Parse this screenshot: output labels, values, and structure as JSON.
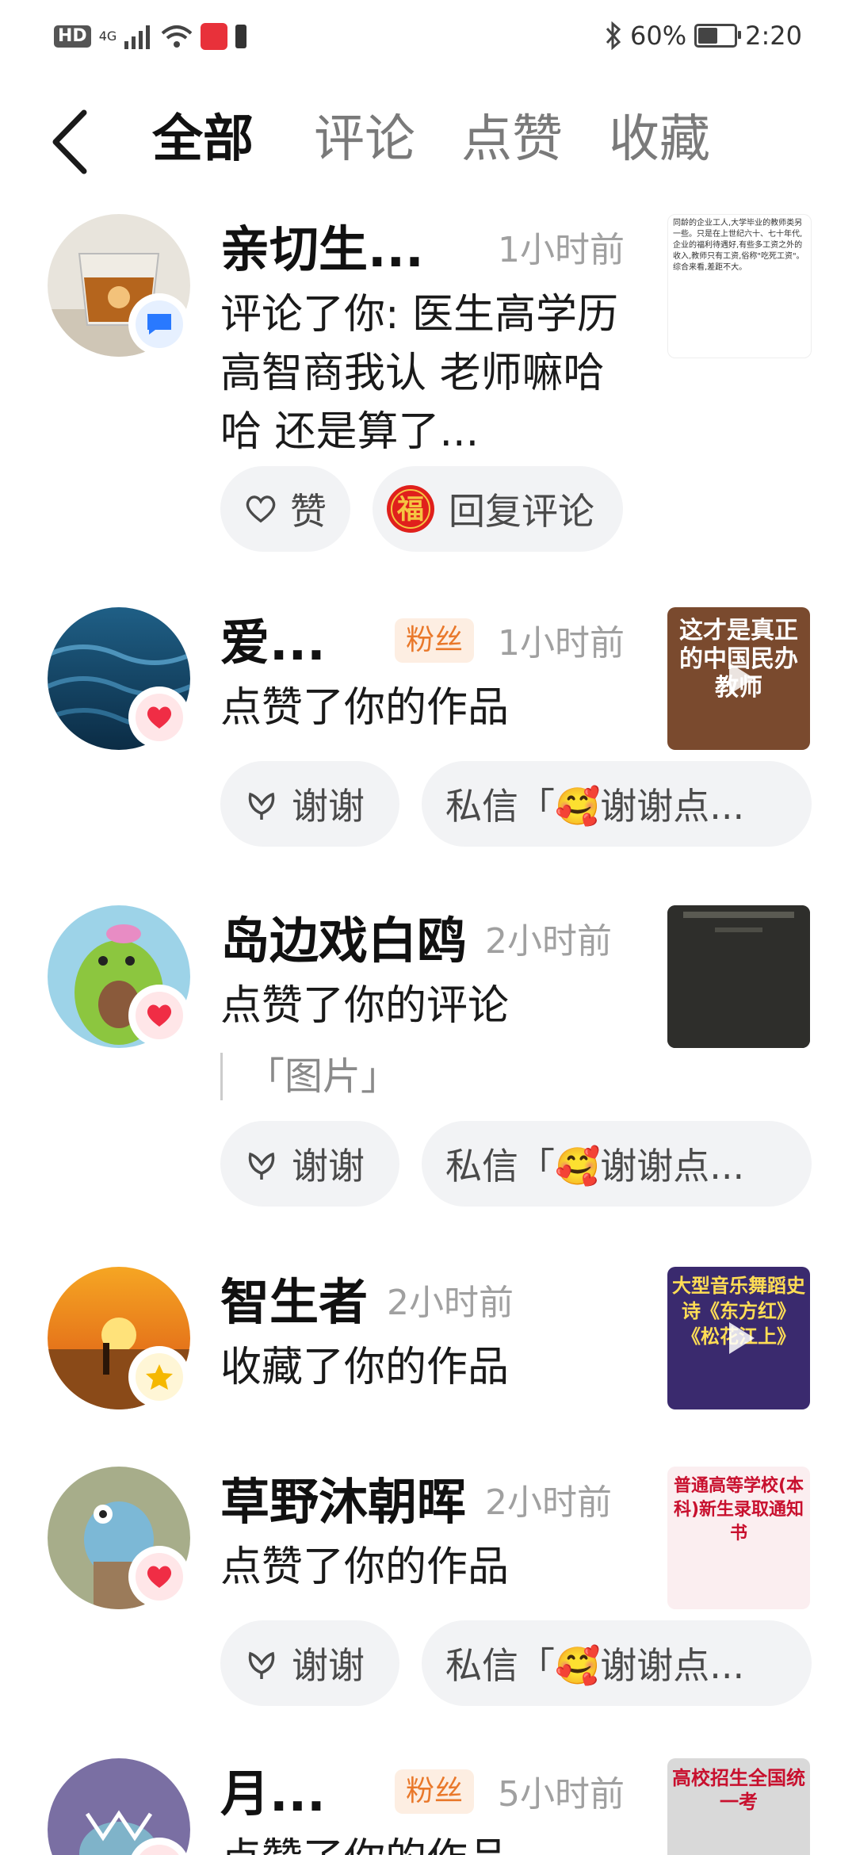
{
  "status_bar": {
    "hd": "HD",
    "network": "4G",
    "battery_text": "60%",
    "battery_level": 0.6,
    "time": "2:20"
  },
  "header": {
    "tabs": [
      {
        "label": "全部",
        "active": true
      },
      {
        "label": "评论",
        "active": false
      },
      {
        "label": "点赞",
        "active": false
      },
      {
        "label": "收藏",
        "active": false
      }
    ]
  },
  "notifications": [
    {
      "name": "亲切生...",
      "time": "1小时前",
      "badge_icon": "comment-icon",
      "action": "评论了你: 医生高学历高智商我认 老师嘛哈哈 还是算了...",
      "buttons": {
        "like": "赞",
        "reply": "回复评论"
      },
      "thumb_text": "同龄的企业工人,大学毕业的教师类另一些。只是在上世纪六十、七十年代,企业的福利待遇好,有些多工资之外的收入,教师只有工资,俗称\"吃死工资\"。综合来看,差距不大。"
    },
    {
      "name": "爱...",
      "fans_label": "粉丝",
      "time": "1小时前",
      "badge_icon": "heart-icon",
      "action": "点赞了你的作品",
      "buttons": {
        "thanks": "谢谢",
        "dm": "私信「🥰谢谢点..."
      },
      "thumb_text": "这才是真正的中国民办教师"
    },
    {
      "name": "岛边戏白鸥",
      "time": "2小时前",
      "badge_icon": "heart-icon",
      "action": "点赞了你的评论",
      "quote": "「图片」",
      "buttons": {
        "thanks": "谢谢",
        "dm": "私信「🥰谢谢点..."
      }
    },
    {
      "name": "智生者",
      "time": "2小时前",
      "badge_icon": "star-icon",
      "action": "收藏了你的作品",
      "thumb_text": "大型音乐舞蹈史诗《东方红》《松花江上》"
    },
    {
      "name": "草野沐朝晖",
      "time": "2小时前",
      "badge_icon": "heart-icon",
      "action": "点赞了你的作品",
      "buttons": {
        "thanks": "谢谢",
        "dm": "私信「🥰谢谢点..."
      },
      "thumb_text": "普通高等学校(本科)新生录取通知书"
    },
    {
      "name": "月...",
      "fans_label": "粉丝",
      "time": "5小时前",
      "badge_icon": "heart-icon",
      "action": "点赞了你的作品",
      "thumb_text": "高校招生全国统一考"
    }
  ]
}
